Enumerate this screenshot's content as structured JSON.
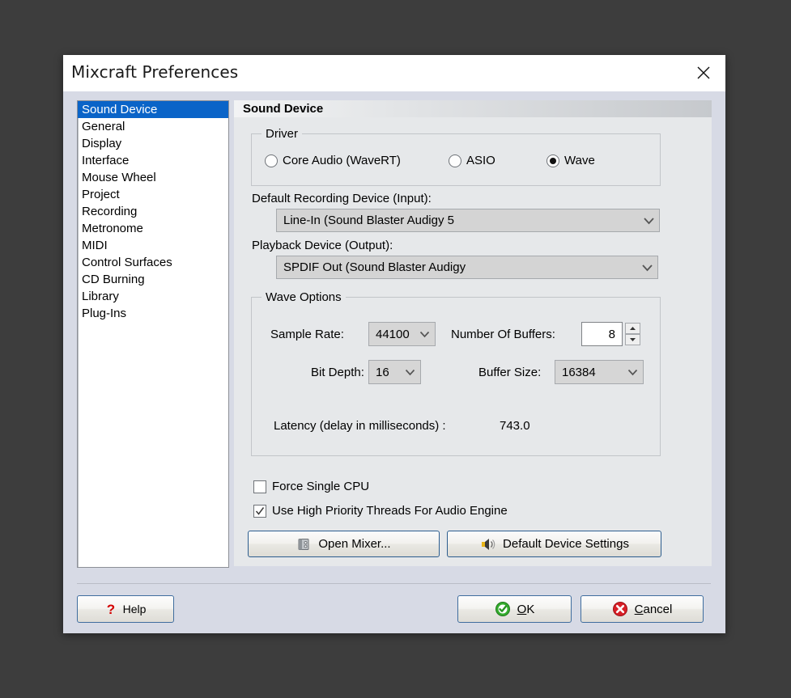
{
  "window": {
    "title": "Mixcraft Preferences",
    "close_icon": "close-icon",
    "desktop_bg": "#3d3d3d",
    "body_bg": "#d7dae5",
    "panel_bg": "#e6e8ea",
    "accent_selection": "#0a64c8"
  },
  "sidebar": {
    "selected_index": 0,
    "items": [
      {
        "label": "Sound Device"
      },
      {
        "label": "General"
      },
      {
        "label": "Display"
      },
      {
        "label": "Interface"
      },
      {
        "label": "Mouse Wheel"
      },
      {
        "label": "Project"
      },
      {
        "label": "Recording"
      },
      {
        "label": "Metronome"
      },
      {
        "label": "MIDI"
      },
      {
        "label": "Control Surfaces"
      },
      {
        "label": "CD Burning"
      },
      {
        "label": "Library"
      },
      {
        "label": "Plug-Ins"
      }
    ]
  },
  "panel": {
    "header": "Sound Device",
    "driver_group": {
      "legend": "Driver",
      "options": [
        {
          "label": "Core Audio (WaveRT)",
          "checked": false
        },
        {
          "label": "ASIO",
          "checked": false
        },
        {
          "label": "Wave",
          "checked": true
        }
      ],
      "selected": "Wave"
    },
    "recording_device": {
      "label": "Default Recording Device (Input):",
      "value": "Line-In (Sound Blaster Audigy 5",
      "arrow_icon": "chevron-down-icon"
    },
    "playback_device": {
      "label": "Playback Device (Output):",
      "value": "SPDIF Out (Sound Blaster Audigy",
      "arrow_icon": "chevron-down-icon"
    },
    "wave_options": {
      "legend": "Wave Options",
      "sample_rate": {
        "label": "Sample Rate:",
        "value": "44100"
      },
      "bit_depth": {
        "label": "Bit Depth:",
        "value": "16"
      },
      "number_of_buffers": {
        "label": "Number Of Buffers:",
        "value": "8"
      },
      "buffer_size": {
        "label": "Buffer Size:",
        "value": "16384"
      },
      "latency": {
        "label": "Latency (delay in milliseconds) :",
        "value": "743.0"
      }
    },
    "checkboxes": [
      {
        "label": "Force Single CPU",
        "checked": false
      },
      {
        "label": "Use High Priority Threads For Audio Engine",
        "checked": true
      }
    ],
    "action_buttons": [
      {
        "label": "Open Mixer...",
        "icon": "mixer-icon"
      },
      {
        "label": "Default Device Settings",
        "icon": "speaker-icon"
      }
    ]
  },
  "footer": {
    "help": {
      "label": "Help",
      "icon": "question-mark-icon"
    },
    "ok": {
      "label_pre": "",
      "label_accel": "O",
      "label_post": "K",
      "icon": "green-check-icon"
    },
    "cancel": {
      "label_pre": "",
      "label_accel": "C",
      "label_post": "ancel",
      "icon": "red-x-icon"
    }
  }
}
